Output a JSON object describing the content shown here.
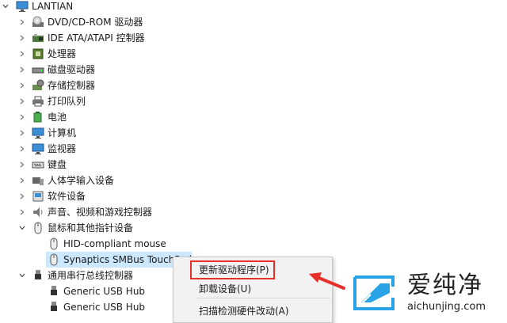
{
  "tree": {
    "root": {
      "label": "LANTIAN",
      "icon": "computer-monitor-icon"
    },
    "categories": [
      {
        "label": "DVD/CD-ROM 驱动器",
        "icon": "dvd-drive-icon"
      },
      {
        "label": "IDE ATA/ATAPI 控制器",
        "icon": "ide-controller-icon"
      },
      {
        "label": "处理器",
        "icon": "processor-chip-icon"
      },
      {
        "label": "磁盘驱动器",
        "icon": "disk-drive-icon"
      },
      {
        "label": "存储控制器",
        "icon": "storage-controller-icon"
      },
      {
        "label": "打印队列",
        "icon": "printer-icon"
      },
      {
        "label": "电池",
        "icon": "battery-icon"
      },
      {
        "label": "计算机",
        "icon": "computer-icon"
      },
      {
        "label": "监视器",
        "icon": "monitor-icon"
      },
      {
        "label": "键盘",
        "icon": "keyboard-icon"
      },
      {
        "label": "人体学输入设备",
        "icon": "hid-icon"
      },
      {
        "label": "软件设备",
        "icon": "software-device-icon"
      },
      {
        "label": "声音、视频和游戏控制器",
        "icon": "speaker-icon"
      }
    ],
    "mice": {
      "label": "鼠标和其他指针设备",
      "icon": "mouse-icon",
      "children": [
        {
          "label": "HID-compliant mouse",
          "icon": "mouse-icon"
        },
        {
          "label": "Synaptics SMBus TouchPad",
          "icon": "mouse-icon",
          "selected": true
        }
      ]
    },
    "usb": {
      "label": "通用串行总线控制器",
      "icon": "usb-icon",
      "children": [
        {
          "label": "Generic USB Hub",
          "icon": "usb-icon"
        },
        {
          "label": "Generic USB Hub",
          "icon": "usb-icon"
        }
      ]
    }
  },
  "context_menu": {
    "items": [
      {
        "label": "更新驱动程序(P)"
      },
      {
        "label": "卸载设备(U)"
      },
      {
        "label": "扫描检测硬件改动(A)"
      }
    ]
  },
  "watermark": {
    "brand": "爱纯净",
    "url": "aichunjing.com"
  },
  "colors": {
    "selection": "#cce8ff",
    "highlight_border": "#e8302a",
    "arrow": "#e8302a",
    "logo_blue": "#2aa3e6"
  }
}
